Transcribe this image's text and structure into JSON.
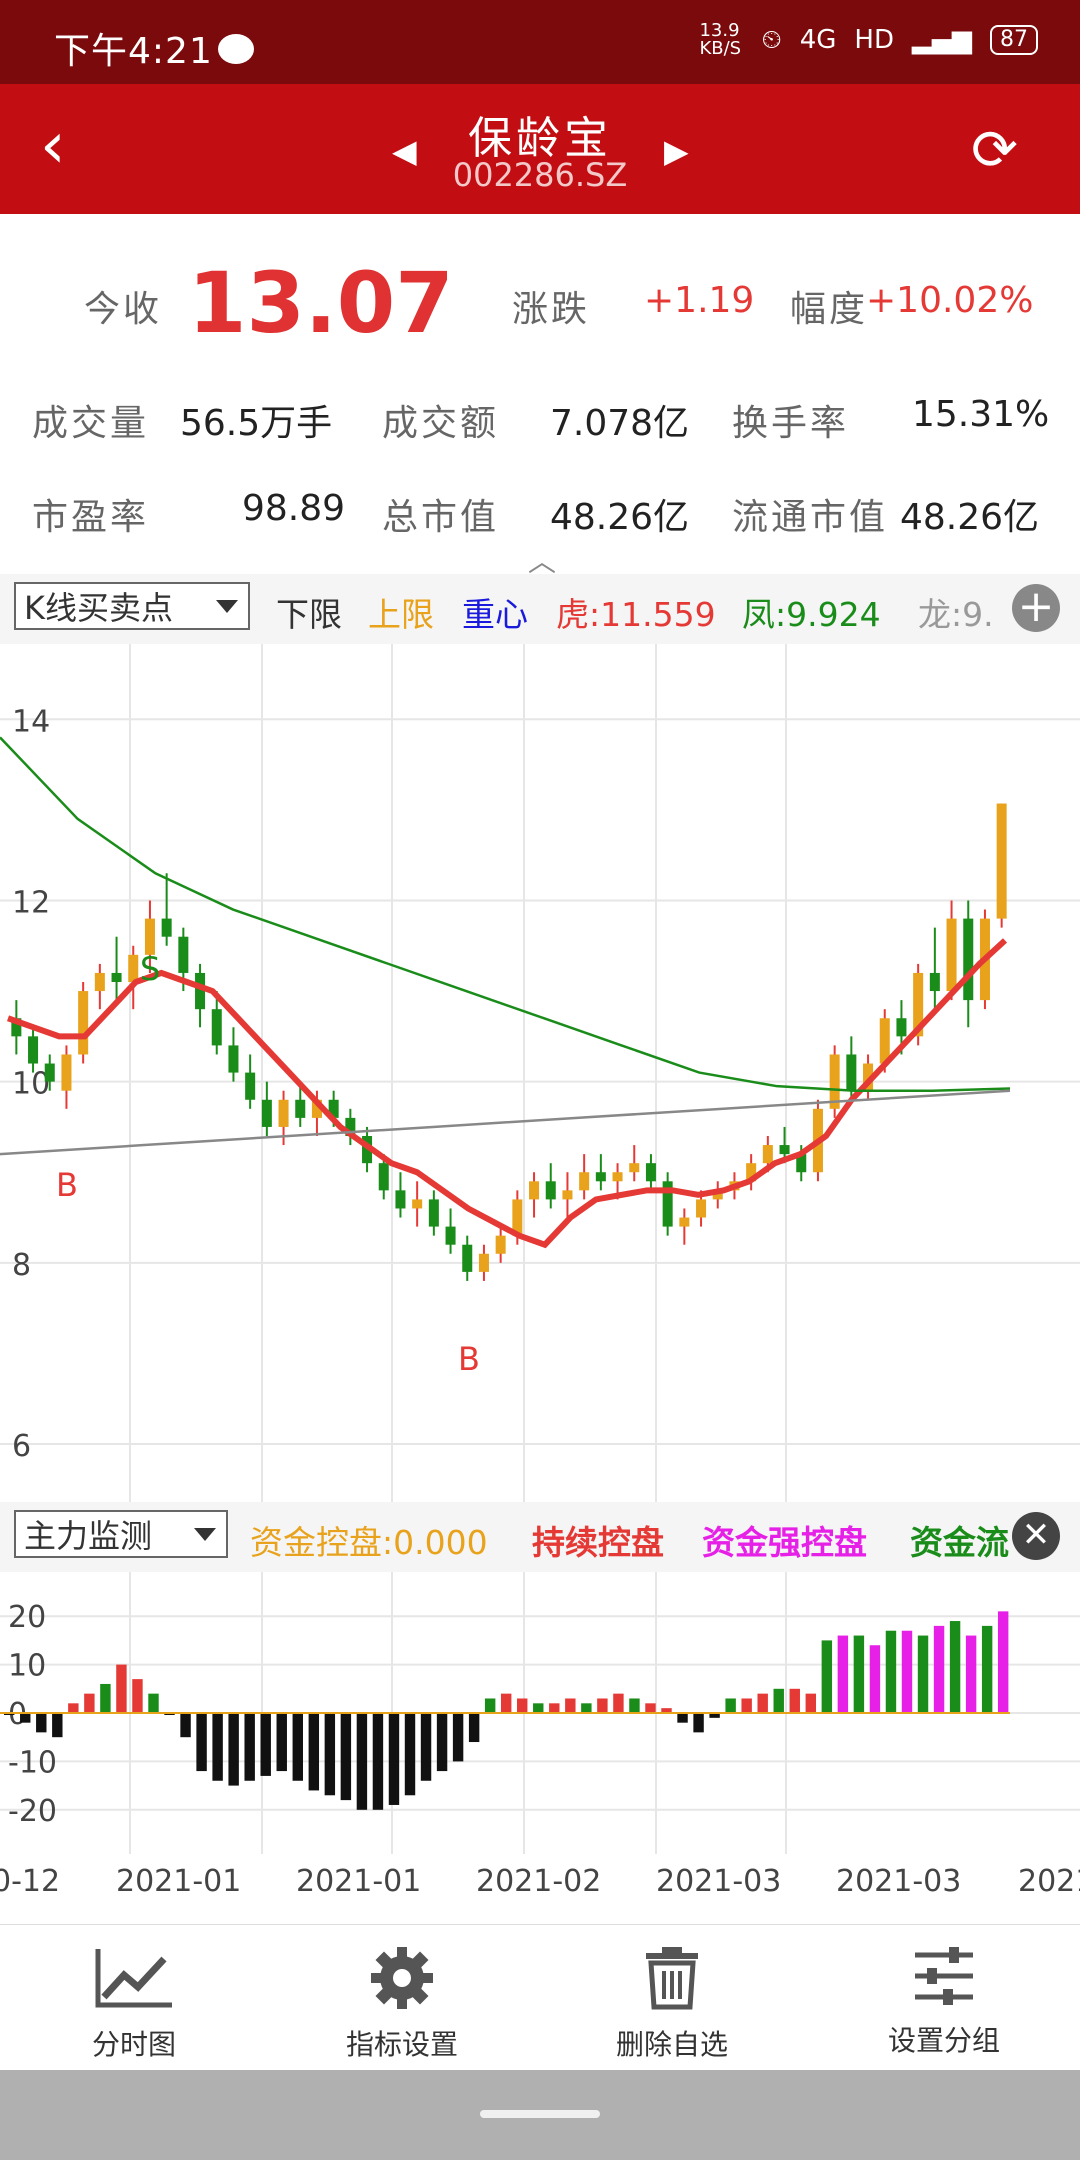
{
  "status": {
    "time": "下午4:21",
    "net_speed": "13.9 KB/S",
    "signal": "4G",
    "hd": "HD",
    "battery": "87"
  },
  "header": {
    "stock_name": "保龄宝",
    "stock_code": "002286.SZ"
  },
  "quote": {
    "close_label": "今收",
    "close_value": "13.07",
    "change_label": "涨跌",
    "change_value": "+1.19",
    "pct_label": "幅度",
    "pct_value": "+10.02%",
    "vol_label": "成交量",
    "vol_value": "56.5万手",
    "amt_label": "成交额",
    "amt_value": "7.078亿",
    "turnover_label": "换手率",
    "turnover_value": "15.31%",
    "pe_label": "市盈率",
    "pe_value": "98.89",
    "mcap_label": "总市值",
    "mcap_value": "48.26亿",
    "float_label": "流通市值",
    "float_value": "48.26亿"
  },
  "main_indicator": {
    "selector": "K线买卖点",
    "legend": [
      {
        "text": "下限",
        "color": "#333333"
      },
      {
        "text": "上限",
        "color": "#e8a21c"
      },
      {
        "text": "重心",
        "color": "#1a1adc"
      },
      {
        "text": "虎:11.559",
        "color": "#e53935"
      },
      {
        "text": "凤:9.924",
        "color": "#1a8c1a"
      },
      {
        "text": "龙:9.",
        "color": "#999999"
      }
    ],
    "y_ticks": [
      "14",
      "12",
      "10",
      "8",
      "6"
    ],
    "markers": [
      "S",
      "B",
      "B"
    ]
  },
  "sub_indicator": {
    "selector": "主力监测",
    "legend": [
      {
        "text": "资金控盘:0.000",
        "color": "#e8a21c"
      },
      {
        "text": "持续控盘",
        "color": "#e53935"
      },
      {
        "text": "资金强控盘",
        "color": "#e620e6"
      },
      {
        "text": "资金流",
        "color": "#1a8c1a"
      }
    ],
    "y_ticks": [
      "20",
      "10",
      "0",
      "-10",
      "-20"
    ]
  },
  "x_axis": [
    "0-12",
    "2021-01",
    "2021-01",
    "2021-02",
    "2021-03",
    "2021-03",
    "2021"
  ],
  "chart_data": {
    "type": "candlestick",
    "ylim": [
      6,
      14.5
    ],
    "candles": [
      [
        10.7,
        10.9,
        10.3,
        10.5
      ],
      [
        10.5,
        10.6,
        10.1,
        10.2
      ],
      [
        10.2,
        10.3,
        9.9,
        10.0
      ],
      [
        9.9,
        10.4,
        9.7,
        10.3
      ],
      [
        10.3,
        11.1,
        10.2,
        11.0
      ],
      [
        11.0,
        11.3,
        10.8,
        11.2
      ],
      [
        11.2,
        11.6,
        10.9,
        11.1
      ],
      [
        11.1,
        11.5,
        10.8,
        11.4
      ],
      [
        11.4,
        12.0,
        11.2,
        11.8
      ],
      [
        11.8,
        12.3,
        11.5,
        11.6
      ],
      [
        11.6,
        11.7,
        11.0,
        11.2
      ],
      [
        11.2,
        11.3,
        10.6,
        10.8
      ],
      [
        10.8,
        11.0,
        10.3,
        10.4
      ],
      [
        10.4,
        10.6,
        10.0,
        10.1
      ],
      [
        10.1,
        10.3,
        9.7,
        9.8
      ],
      [
        9.8,
        10.0,
        9.4,
        9.5
      ],
      [
        9.5,
        9.9,
        9.3,
        9.8
      ],
      [
        9.8,
        10.0,
        9.5,
        9.6
      ],
      [
        9.6,
        9.9,
        9.4,
        9.8
      ],
      [
        9.8,
        9.9,
        9.5,
        9.6
      ],
      [
        9.6,
        9.7,
        9.3,
        9.4
      ],
      [
        9.4,
        9.5,
        9.0,
        9.1
      ],
      [
        9.1,
        9.2,
        8.7,
        8.8
      ],
      [
        8.8,
        9.0,
        8.5,
        8.6
      ],
      [
        8.6,
        8.9,
        8.4,
        8.7
      ],
      [
        8.7,
        8.8,
        8.3,
        8.4
      ],
      [
        8.4,
        8.6,
        8.1,
        8.2
      ],
      [
        8.2,
        8.3,
        7.8,
        7.9
      ],
      [
        7.9,
        8.2,
        7.8,
        8.1
      ],
      [
        8.1,
        8.4,
        8.0,
        8.3
      ],
      [
        8.3,
        8.8,
        8.2,
        8.7
      ],
      [
        8.7,
        9.0,
        8.5,
        8.9
      ],
      [
        8.9,
        9.1,
        8.6,
        8.7
      ],
      [
        8.7,
        9.0,
        8.5,
        8.8
      ],
      [
        8.8,
        9.2,
        8.7,
        9.0
      ],
      [
        9.0,
        9.2,
        8.8,
        8.9
      ],
      [
        8.9,
        9.1,
        8.7,
        9.0
      ],
      [
        9.0,
        9.3,
        8.9,
        9.1
      ],
      [
        9.1,
        9.2,
        8.8,
        8.9
      ],
      [
        8.9,
        9.0,
        8.3,
        8.4
      ],
      [
        8.4,
        8.6,
        8.2,
        8.5
      ],
      [
        8.5,
        8.8,
        8.4,
        8.7
      ],
      [
        8.7,
        8.9,
        8.6,
        8.8
      ],
      [
        8.8,
        9.0,
        8.7,
        8.9
      ],
      [
        8.9,
        9.2,
        8.8,
        9.1
      ],
      [
        9.1,
        9.4,
        9.0,
        9.3
      ],
      [
        9.3,
        9.5,
        9.1,
        9.2
      ],
      [
        9.2,
        9.3,
        8.9,
        9.0
      ],
      [
        9.0,
        9.8,
        8.9,
        9.7
      ],
      [
        9.7,
        10.4,
        9.6,
        10.3
      ],
      [
        10.3,
        10.5,
        9.8,
        9.9
      ],
      [
        9.9,
        10.3,
        9.8,
        10.2
      ],
      [
        10.2,
        10.8,
        10.1,
        10.7
      ],
      [
        10.7,
        10.9,
        10.3,
        10.5
      ],
      [
        10.5,
        11.3,
        10.4,
        11.2
      ],
      [
        11.2,
        11.7,
        10.8,
        11.0
      ],
      [
        11.0,
        12.0,
        10.9,
        11.8
      ],
      [
        11.8,
        12.0,
        10.6,
        10.9
      ],
      [
        10.9,
        11.9,
        10.8,
        11.8
      ],
      [
        11.8,
        13.07,
        11.7,
        13.07
      ]
    ],
    "series": [
      {
        "name": "虎",
        "color": "#e53935",
        "values": [
          10.7,
          10.6,
          10.5,
          10.5,
          10.8,
          11.1,
          11.2,
          11.1,
          11.0,
          10.7,
          10.4,
          10.1,
          9.8,
          9.5,
          9.3,
          9.1,
          9.0,
          8.8,
          8.6,
          8.45,
          8.3,
          8.2,
          8.5,
          8.7,
          8.75,
          8.8,
          8.8,
          8.75,
          8.8,
          8.9,
          9.1,
          9.2,
          9.4,
          9.8,
          10.1,
          10.4,
          10.7,
          11.0,
          11.3,
          11.559
        ]
      },
      {
        "name": "凤",
        "color": "#1a8c1a",
        "values": [
          13.8,
          12.9,
          12.3,
          11.9,
          11.6,
          11.3,
          11.0,
          10.7,
          10.4,
          10.1,
          9.95,
          9.9,
          9.9,
          9.924
        ]
      },
      {
        "name": "龙",
        "color": "#888888",
        "values": [
          9.2,
          9.3,
          9.4,
          9.5,
          9.6,
          9.7,
          9.8,
          9.9
        ]
      }
    ],
    "sub_values": [
      0,
      -2,
      -4,
      -5,
      2,
      4,
      6,
      10,
      7,
      4,
      0,
      -5,
      -12,
      -14,
      -15,
      -14,
      -13,
      -12,
      -14,
      -16,
      -17,
      -18,
      -20,
      -20,
      -19,
      -17,
      -14,
      -12,
      -10,
      -6,
      3,
      4,
      3,
      2,
      2,
      3,
      2,
      3,
      4,
      3,
      2,
      1,
      -2,
      -4,
      -1,
      3,
      3,
      4,
      5,
      5,
      4,
      15,
      16,
      16,
      14,
      17,
      17,
      16,
      18,
      19,
      16,
      18,
      21
    ]
  },
  "bottom_nav": [
    {
      "label": "分时图",
      "icon": "chart-line-icon"
    },
    {
      "label": "指标设置",
      "icon": "gear-icon"
    },
    {
      "label": "删除自选",
      "icon": "trash-icon"
    },
    {
      "label": "设置分组",
      "icon": "sliders-icon"
    }
  ]
}
